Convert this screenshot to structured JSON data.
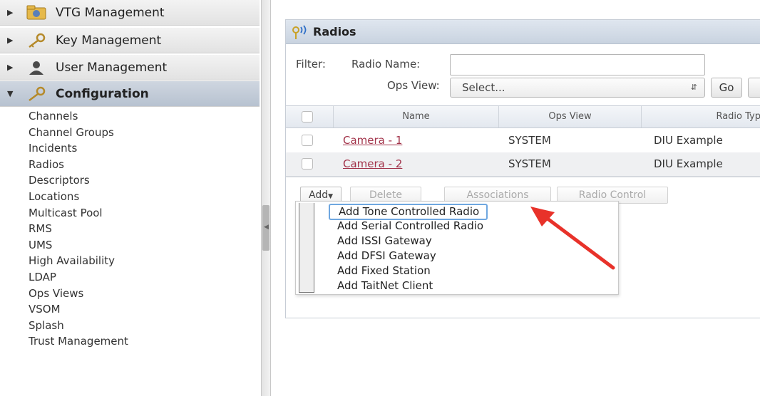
{
  "sidebar": {
    "sections": [
      {
        "label": "VTG Management",
        "icon": "vtg-folder-icon",
        "expanded": false
      },
      {
        "label": "Key Management",
        "icon": "key-icon",
        "expanded": false
      },
      {
        "label": "User Management",
        "icon": "user-icon",
        "expanded": false
      },
      {
        "label": "Configuration",
        "icon": "wrench-icon",
        "expanded": true
      }
    ],
    "config_items": [
      "Channels",
      "Channel Groups",
      "Incidents",
      "Radios",
      "Descriptors",
      "Locations",
      "Multicast Pool",
      "RMS",
      "UMS",
      "High Availability",
      "LDAP",
      "Ops Views",
      "VSOM",
      "Splash",
      "Trust Management"
    ]
  },
  "panel": {
    "title": "Radios",
    "filter": {
      "label": "Filter:",
      "radio_name_label": "Radio Name:",
      "radio_name_value": "",
      "ops_view_label": "Ops View:",
      "ops_view_value": "Select...",
      "go_label": "Go"
    },
    "table": {
      "headers": [
        "Name",
        "Ops View",
        "Radio Typ"
      ],
      "rows": [
        {
          "name": "Camera - 1",
          "ops_view": "SYSTEM",
          "radio_type": "DIU Example"
        },
        {
          "name": "Camera - 2",
          "ops_view": "SYSTEM",
          "radio_type": "DIU Example"
        }
      ]
    },
    "actions": {
      "add": "Add",
      "delete": "Delete",
      "associations": "Associations",
      "radio_control": "Radio Control"
    },
    "add_menu": [
      "Add Tone Controlled Radio",
      "Add Serial Controlled Radio",
      "Add ISSI Gateway",
      "Add DFSI Gateway",
      "Add Fixed Station",
      "Add TaitNet Client"
    ]
  },
  "colors": {
    "accent_highlight": "#6fa7e0",
    "link": "#a2334a",
    "annotation_arrow": "#e8322a"
  }
}
